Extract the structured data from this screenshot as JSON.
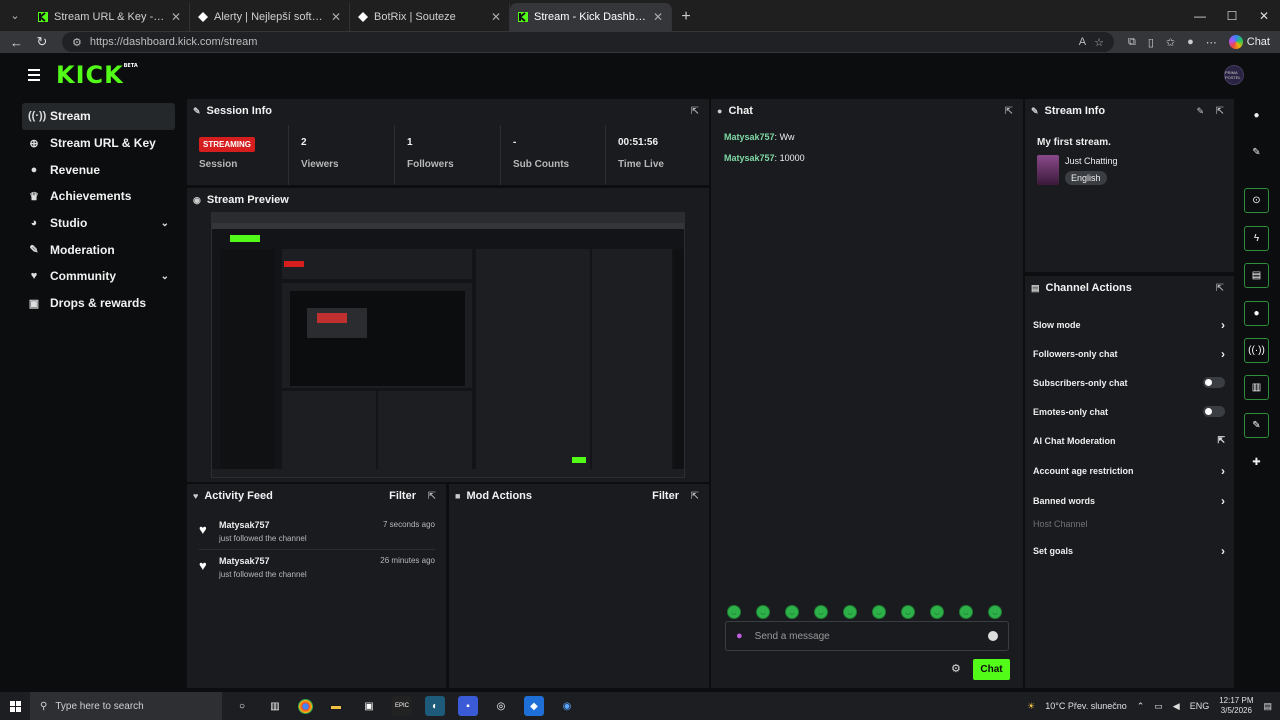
{
  "browser": {
    "tabs": [
      {
        "label": "Stream URL & Key - Kick Dashboa",
        "icon": "kick"
      },
      {
        "label": "Alerty | Nejlepší software pro vylep",
        "icon": "alerty"
      },
      {
        "label": "BotRix | Souteze",
        "icon": "botrix"
      },
      {
        "label": "Stream - Kick Dashboard",
        "icon": "kick",
        "active": true
      }
    ],
    "url": "https://dashboard.kick.com/stream",
    "chat_label": "Chat"
  },
  "app": {
    "logo": "KICK",
    "logo_tag": "BETA",
    "avatar_text": "PRIMA POSTEL"
  },
  "sidebar": {
    "items": [
      {
        "label": "Stream",
        "icon": "antenna-icon",
        "active": true
      },
      {
        "label": "Stream URL & Key",
        "icon": "globe-icon"
      },
      {
        "label": "Revenue",
        "icon": "coins-icon"
      },
      {
        "label": "Achievements",
        "icon": "trophy-icon"
      },
      {
        "label": "Studio",
        "icon": "palette-icon",
        "chevron": true
      },
      {
        "label": "Moderation",
        "icon": "wrench-icon"
      },
      {
        "label": "Community",
        "icon": "community-icon",
        "chevron": true
      },
      {
        "label": "Drops & rewards",
        "icon": "gift-icon"
      }
    ]
  },
  "session": {
    "title": "Session Info",
    "badge": "STREAMING",
    "stats": [
      {
        "value": "",
        "label": "Session"
      },
      {
        "value": "2",
        "label": "Viewers"
      },
      {
        "value": "1",
        "label": "Followers"
      },
      {
        "value": "-",
        "label": "Sub Counts"
      },
      {
        "value": "00:51:56",
        "label": "Time Live"
      }
    ]
  },
  "preview": {
    "title": "Stream Preview"
  },
  "chat": {
    "title": "Chat",
    "messages": [
      {
        "user": "Matysak757",
        "text": "Ww"
      },
      {
        "user": "Matysak757",
        "text": "10000"
      }
    ],
    "placeholder": "Send a message",
    "send_label": "Chat"
  },
  "stream_info": {
    "title": "Stream Info",
    "stream_title": "My first stream.",
    "category": "Just Chatting",
    "language": "English"
  },
  "channel_actions": {
    "title": "Channel Actions",
    "items": [
      {
        "label": "Slow mode",
        "control": "chevron"
      },
      {
        "label": "Followers-only chat",
        "control": "chevron"
      },
      {
        "label": "Subscribers-only chat",
        "control": "toggle"
      },
      {
        "label": "Emotes-only chat",
        "control": "toggle"
      },
      {
        "label": "AI Chat Moderation",
        "control": "external"
      },
      {
        "label": "Account age restriction",
        "control": "chevron"
      },
      {
        "label": "Banned words",
        "control": "chevron"
      },
      {
        "label": "Host Channel",
        "control": "none",
        "disabled": true
      },
      {
        "label": "Set goals",
        "control": "chevron"
      }
    ]
  },
  "activity": {
    "title": "Activity Feed",
    "filter_label": "Filter",
    "items": [
      {
        "user": "Matysak757",
        "text": "just followed the channel",
        "when": "7 seconds ago"
      },
      {
        "user": "Matysak757",
        "text": "just followed the channel",
        "when": "26 minutes ago"
      }
    ]
  },
  "mod_actions": {
    "title": "Mod Actions",
    "filter_label": "Filter"
  },
  "taskbar": {
    "search_placeholder": "Type here to search",
    "weather": "10°C  Přev. slunečno",
    "language": "ENG",
    "time": "12:17 PM",
    "date": "3/5/2026"
  },
  "colors": {
    "accent": "#53fc18",
    "live": "#d71e1e",
    "panel": "#191b1f",
    "bg": "#0b0d0e"
  }
}
